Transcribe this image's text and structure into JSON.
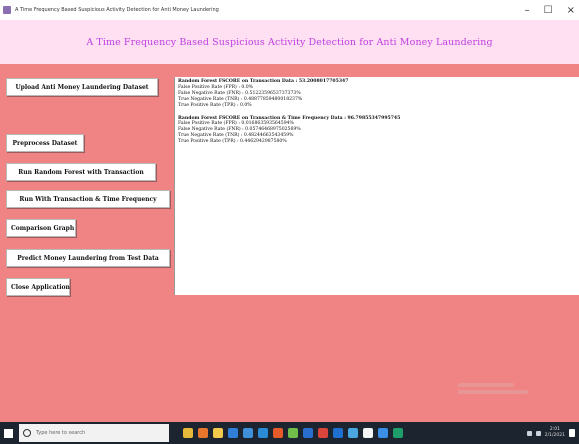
{
  "window": {
    "title": "A Time Frequency Based Suspicious Activity Detection for Anti Money Laundering",
    "controls": [
      "–",
      "☐",
      "×"
    ]
  },
  "header": {
    "title": "A Time Frequency Based Suspicious Activity Detection for Anti Money Laundering",
    "background": "#ffe0f3",
    "title_color": "#c040e0"
  },
  "sidebar": {
    "buttons": [
      {
        "label": "Upload Anti Money Laundering Dataset"
      },
      {
        "label": "Preprocess Dataset"
      },
      {
        "label": "Run Random Forest with Transaction"
      },
      {
        "label": "Run With Transaction & Time Frequency"
      },
      {
        "label": "Comparison Graph"
      },
      {
        "label": "Predict Money Laundering from Test Data"
      },
      {
        "label": "Close Application"
      }
    ]
  },
  "output": {
    "lines": [
      "Random Forest FSCORE on Transaction Data : 53.2008017705347",
      "False Positive Rate (FPR) : 0.0%",
      "False Negative Rate (FNR) : 0.5122359653737373%",
      "True Negative Rate (TNR) : 0.48877859480018237%",
      "True Positive Rate (TPR) : 0.0%",
      "",
      "Random Forest FSCORE on Transaction & Time Frequency Data : 96.79855347995745",
      "False Positive Rate (FPR) : 0.016863593564594%",
      "False Negative Rate (FNR) : 0.0574646897502569%",
      "True Negative Rate (TNR) : 0.48244663543459%",
      "True Positive Rate (TPR) : 0.4462942987580%"
    ]
  },
  "taskbar": {
    "search_placeholder": "Type here to search",
    "clock_time": "2:01",
    "clock_date": "2/1/2021",
    "icon_colors": [
      "#e7b93a",
      "#e8772e",
      "#f2c94c",
      "#2f7ed8",
      "#3f8fdb",
      "#2b8ad6",
      "#e55a2b",
      "#6fbf4a",
      "#2a6fcf",
      "#d9453b",
      "#1f6fd1",
      "#4aa6e0",
      "#f4f4f4",
      "#3a8ee6",
      "#1e9e6a"
    ]
  },
  "colors": {
    "page_background": "#f08484",
    "taskbar": "#1c2430"
  }
}
